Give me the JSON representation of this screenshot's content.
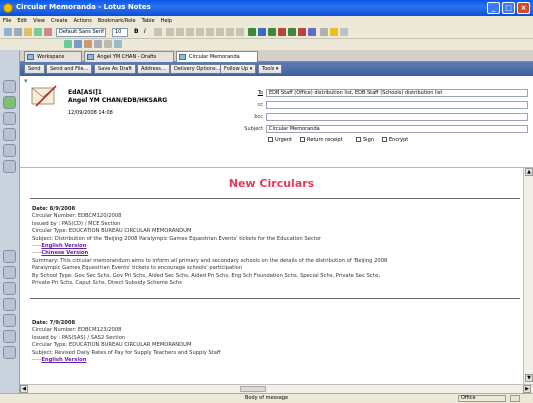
{
  "window": {
    "title": "Circular Memoranda - Lotus Notes"
  },
  "menu": [
    "File",
    "Edit",
    "View",
    "Create",
    "Actions",
    "Bookmark/Role",
    "Table",
    "Help"
  ],
  "toolbar": {
    "style_select": "Default Sans Serif",
    "size_select": "10"
  },
  "tabs": [
    {
      "label": "Workspace"
    },
    {
      "label": "Angel YM CHAN - Drafts"
    },
    {
      "label": "Circular Memoranda"
    }
  ],
  "actions": [
    "Send",
    "Send and File...",
    "Save As Draft",
    "Address...",
    "Delivery Options...",
    "Follow Up",
    "Tools"
  ],
  "memo": {
    "sender_id": "EdA[ASI]1",
    "sender_name": "Angel YM CHAN/EDB/HKSARG",
    "date": "12/09/2008 14:08",
    "to_label": "To",
    "to_value": "EDB Staff (Office) distribution list, EDB Staff (Schools) distribution list",
    "cc_label": "cc",
    "bcc_label": "bcc",
    "subject_label": "Subject",
    "subject_value": "Circular Memoranda",
    "options": [
      "Urgent",
      "Return receipt",
      "Sign",
      "Encrypt"
    ]
  },
  "body": {
    "heading": "New Circulars",
    "entries": [
      {
        "date": "Date: 8/9/2008",
        "number": "Circular Number: EDBCM120/2008",
        "issued": "Issued by : PAS(CD) / MCE Section",
        "type": "Circular Type: EDUCATION BUREAU CIRCULAR MEMORANDUM",
        "subject": "Subject: Distribution of the 'Beijing 2008 Paralympic Games Equestrian Events' tickets for the Education Sector",
        "english": "English Version",
        "chinese": "Chinese Version",
        "summary": "Summary: This circular memorandum aims to inform all primary and secondary schools on the details of the distribution of 'Beijing 2008",
        "summary2": "Paralympic Games Equestrian Events' tickets to encourage schools' participation",
        "school_type": "By School Type: Gov Sec Schs, Gov Pri Schs, Aided Sec Schs, Aided Pri Schs, Eng Sch Foundation Schs, Special Schs, Private Sec Schs,",
        "school_type2": "Private Pri Schs, Caput Schs, Direct Subsidy Scheme Schs"
      },
      {
        "date": "Date: 7/9/2008",
        "number": "Circular Number: EDBCM123/2008",
        "issued": "Issued by : PAS(SAS) / SAS2 Section",
        "type": "Circular Type: EDUCATION BUREAU CIRCULAR MEMORANDUM",
        "subject": "Subject: Revised Daily Rates of Pay for Supply Teachers and Supply Staff",
        "english": "English Version"
      }
    ]
  },
  "status": {
    "hscroll_label": "Body of message",
    "office": "Office"
  }
}
